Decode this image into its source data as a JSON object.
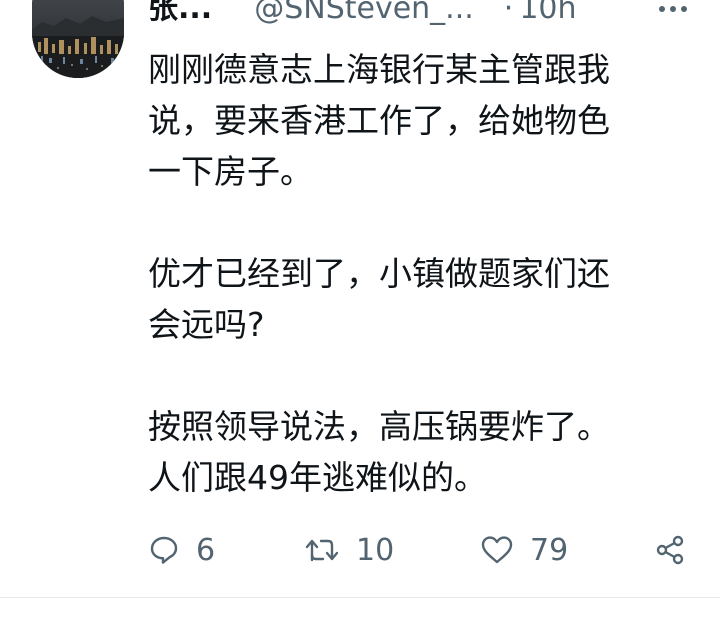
{
  "tweet": {
    "author_name": "张...",
    "handle": "@SNSteven_...",
    "separator": "·",
    "time": "10h",
    "paragraphs": [
      {
        "lines": [
          "刚刚德意志上海银行某主管跟我",
          "说，要来香港工作了，给她物色",
          "一下房子。"
        ]
      },
      {
        "lines": [
          "优才已经到了，小镇做题家们还",
          "会远吗?"
        ]
      },
      {
        "lines": [
          "按照领导说法，高压锅要炸了。",
          "人们跟49年逃难似的。"
        ]
      }
    ],
    "actions": {
      "reply_count": "6",
      "retweet_count": "10",
      "like_count": "79"
    }
  },
  "icons": {
    "more": "more-horizontal-icon",
    "reply": "reply-bubble-icon",
    "retweet": "retweet-icon",
    "like": "heart-icon",
    "share": "share-icon"
  },
  "colors": {
    "text": "#0f1419",
    "secondary": "#536471",
    "divider": "#e6ecf0"
  }
}
